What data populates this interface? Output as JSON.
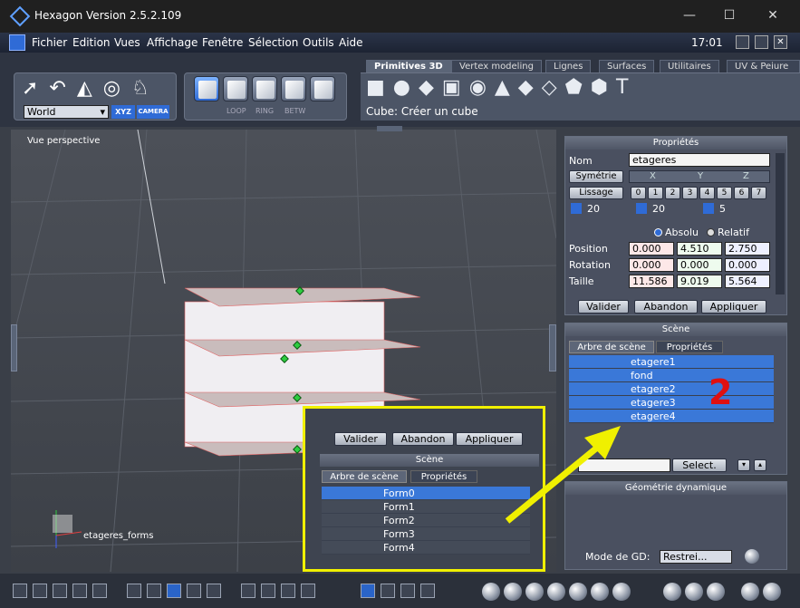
{
  "window": {
    "title": "Hexagon Version 2.5.2.109",
    "clock": "17:01"
  },
  "menu": [
    "Fichier",
    "Edition",
    "Vues",
    "Affichage",
    "Fenêtre",
    "Sélection",
    "Outils",
    "Aide"
  ],
  "toolbar": {
    "coord_select": "World",
    "xyz_label": "XYZ",
    "camera_label": "CAMERA",
    "edge_tools": [
      "LOOP",
      "RING",
      "BETW"
    ],
    "tabs": [
      "Primitives 3D",
      "Vertex modeling",
      "Lignes",
      "Surfaces",
      "Utilitaires",
      "UV & Peiure"
    ],
    "status": "Cube: Créer un cube"
  },
  "viewport": {
    "label": "Vue perspective",
    "axis_label": "etageres_forms",
    "annotation": "2"
  },
  "properties": {
    "title": "Propriétés",
    "name_label": "Nom",
    "name_value": "etageres",
    "symmetry_label": "Symétrie",
    "axes": [
      "X",
      "Y",
      "Z"
    ],
    "smoothing_label": "Lissage",
    "smoothing_levels": [
      "0",
      "1",
      "2",
      "3",
      "4",
      "5",
      "6",
      "7"
    ],
    "segments": [
      "20",
      "20",
      "5"
    ],
    "absolute_label": "Absolu",
    "relative_label": "Relatif",
    "position_label": "Position",
    "position": [
      "0.000",
      "4.510",
      "2.750"
    ],
    "rotation_label": "Rotation",
    "rotation": [
      "0.000",
      "0.000",
      "0.000"
    ],
    "size_label": "Taille",
    "size": [
      "11.586",
      "9.019",
      "5.564"
    ],
    "validate": "Valider",
    "cancel": "Abandon",
    "apply": "Appliquer"
  },
  "scene": {
    "title": "Scène",
    "tab_tree": "Arbre de scène",
    "tab_props": "Propriétés",
    "items": [
      "etagere1",
      "fond",
      "etagere2",
      "etagere3",
      "etagere4"
    ],
    "select_button": "Select."
  },
  "dynamic_geometry": {
    "title": "Géométrie dynamique",
    "mode_label": "Mode de GD:",
    "mode_value": "Restrei..."
  },
  "inset": {
    "validate": "Valider",
    "cancel": "Abandon",
    "apply": "Appliquer",
    "scene_title": "Scène",
    "tab_tree": "Arbre de scène",
    "tab_props": "Propriétés",
    "items": [
      "Form0",
      "Form1",
      "Form2",
      "Form3",
      "Form4"
    ]
  },
  "colors": {
    "highlight_yellow": "#f0f000",
    "selection_blue": "#3a78d8",
    "annotation_red": "#e01010"
  }
}
